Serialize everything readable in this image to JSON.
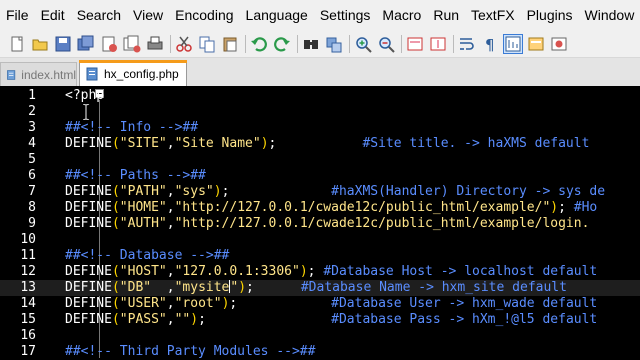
{
  "menu": [
    "File",
    "Edit",
    "Search",
    "View",
    "Encoding",
    "Language",
    "Settings",
    "Macro",
    "Run",
    "TextFX",
    "Plugins",
    "Window"
  ],
  "toolbar": {
    "icons": [
      "new-file-icon",
      "open-file-icon",
      "save-icon",
      "save-all-icon",
      "close-icon",
      "close-all-icon",
      "print-icon",
      "cut-icon",
      "copy-icon",
      "paste-icon",
      "undo-icon",
      "redo-icon",
      "find-icon",
      "replace-icon",
      "zoom-in-icon",
      "zoom-out-icon",
      "sync-v-icon",
      "sync-h-icon",
      "word-wrap-icon",
      "show-all-chars-icon",
      "indent-guide-icon",
      "user-lang-icon",
      "record-macro-icon"
    ]
  },
  "tabs": [
    {
      "label": "index.html",
      "active": false
    },
    {
      "label": "hx_config.php",
      "active": true
    }
  ],
  "editor": {
    "lines": [
      {
        "n": "1",
        "segs": [
          [
            "plain",
            "<?php"
          ]
        ],
        "fold": true
      },
      {
        "n": "2",
        "segs": []
      },
      {
        "n": "3",
        "segs": [
          [
            "hdr",
            "##<!-- Info -->##"
          ]
        ]
      },
      {
        "n": "4",
        "segs": [
          [
            "kw",
            "DEFINE"
          ],
          [
            "paren",
            "("
          ],
          [
            "str",
            "\"SITE\""
          ],
          [
            "plain",
            ","
          ],
          [
            "str",
            "\"Site Name\""
          ],
          [
            "paren",
            ")"
          ],
          [
            "plain",
            ";           "
          ],
          [
            "cmt",
            "#Site title. -> haXMS default"
          ]
        ]
      },
      {
        "n": "5",
        "segs": []
      },
      {
        "n": "6",
        "segs": [
          [
            "hdr",
            "##<!-- Paths -->##"
          ]
        ]
      },
      {
        "n": "7",
        "segs": [
          [
            "kw",
            "DEFINE"
          ],
          [
            "paren",
            "("
          ],
          [
            "str",
            "\"PATH\""
          ],
          [
            "plain",
            ","
          ],
          [
            "str",
            "\"sys\""
          ],
          [
            "paren",
            ")"
          ],
          [
            "plain",
            ";             "
          ],
          [
            "cmt",
            "#haXMS(Handler) Directory -> sys de"
          ]
        ]
      },
      {
        "n": "8",
        "segs": [
          [
            "kw",
            "DEFINE"
          ],
          [
            "paren",
            "("
          ],
          [
            "str",
            "\"HOME\""
          ],
          [
            "plain",
            ","
          ],
          [
            "str",
            "\"http://127.0.0.1/cwade12c/public_html/example/\""
          ],
          [
            "paren",
            ")"
          ],
          [
            "plain",
            "; "
          ],
          [
            "cmt",
            "#Ho"
          ]
        ]
      },
      {
        "n": "9",
        "segs": [
          [
            "kw",
            "DEFINE"
          ],
          [
            "paren",
            "("
          ],
          [
            "str",
            "\"AUTH\""
          ],
          [
            "plain",
            ","
          ],
          [
            "str",
            "\"http://127.0.0.1/cwade12c/public_html/example/login."
          ]
        ]
      },
      {
        "n": "10",
        "segs": []
      },
      {
        "n": "11",
        "segs": [
          [
            "hdr",
            "##<!-- Database -->##"
          ]
        ]
      },
      {
        "n": "12",
        "segs": [
          [
            "kw",
            "DEFINE"
          ],
          [
            "paren",
            "("
          ],
          [
            "str",
            "\"HOST\""
          ],
          [
            "plain",
            ","
          ],
          [
            "str",
            "\"127.0.0.1:3306\""
          ],
          [
            "paren",
            ")"
          ],
          [
            "plain",
            "; "
          ],
          [
            "cmt",
            "#Database Host -> localhost default"
          ]
        ]
      },
      {
        "n": "13",
        "segs": [
          [
            "kw",
            "DEFINE"
          ],
          [
            "paren",
            "("
          ],
          [
            "str",
            "\"DB\""
          ],
          [
            "plain",
            "  ,"
          ],
          [
            "str",
            "\"mysite"
          ],
          [
            "caret",
            ""
          ],
          [
            "str",
            "\""
          ],
          [
            "paren",
            ")"
          ],
          [
            "plain",
            ";      "
          ],
          [
            "cmt",
            "#Database Name -> hxm_site default"
          ]
        ],
        "current": true
      },
      {
        "n": "14",
        "segs": [
          [
            "kw",
            "DEFINE"
          ],
          [
            "paren",
            "("
          ],
          [
            "str",
            "\"USER\""
          ],
          [
            "plain",
            ","
          ],
          [
            "str",
            "\"root\""
          ],
          [
            "paren",
            ")"
          ],
          [
            "plain",
            ";            "
          ],
          [
            "cmt",
            "#Database User -> hxm_wade default"
          ]
        ]
      },
      {
        "n": "15",
        "segs": [
          [
            "kw",
            "DEFINE"
          ],
          [
            "paren",
            "("
          ],
          [
            "str",
            "\"PASS\""
          ],
          [
            "plain",
            ","
          ],
          [
            "str",
            "\"\""
          ],
          [
            "paren",
            ")"
          ],
          [
            "plain",
            ";                "
          ],
          [
            "cmt",
            "#Database Pass -> hXm_!@l5 default"
          ]
        ]
      },
      {
        "n": "16",
        "segs": []
      },
      {
        "n": "17",
        "segs": [
          [
            "hdr",
            "##<!-- Third Party Modules -->##"
          ]
        ]
      }
    ]
  }
}
